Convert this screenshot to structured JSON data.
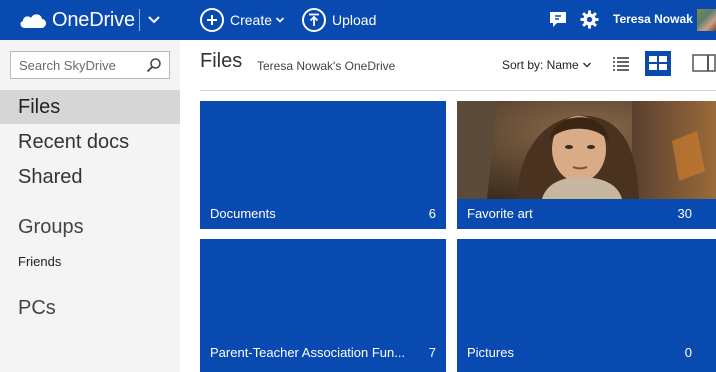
{
  "header": {
    "brand": "OneDrive",
    "create_label": "Create",
    "upload_label": "Upload",
    "user_name": "Teresa Nowak",
    "icons": [
      "cloud-icon",
      "chevron-down-icon",
      "plus-icon",
      "upload-icon",
      "feedback-icon",
      "gear-icon"
    ],
    "colors": {
      "bar": "#094ab1",
      "text": "#ffffff"
    }
  },
  "sidebar": {
    "search_placeholder": "Search SkyDrive",
    "nav": {
      "files": "Files",
      "recent": "Recent docs",
      "shared": "Shared",
      "groups_heading": "Groups",
      "friends": "Friends",
      "pcs": "PCs"
    }
  },
  "main": {
    "title": "Files",
    "breadcrumb": "Teresa Nowak's OneDrive",
    "sort_label": "Sort by: Name",
    "tiles": [
      {
        "name": "Documents",
        "count": "6"
      },
      {
        "name": "Favorite art",
        "count": "30"
      },
      {
        "name": "Parent-Teacher Association Fun...",
        "count": "7"
      },
      {
        "name": "Pictures",
        "count": "0"
      }
    ],
    "colors": {
      "tile": "#094ab1",
      "sidebar": "#f4f4f4",
      "active_nav": "#d6d6d6"
    }
  }
}
